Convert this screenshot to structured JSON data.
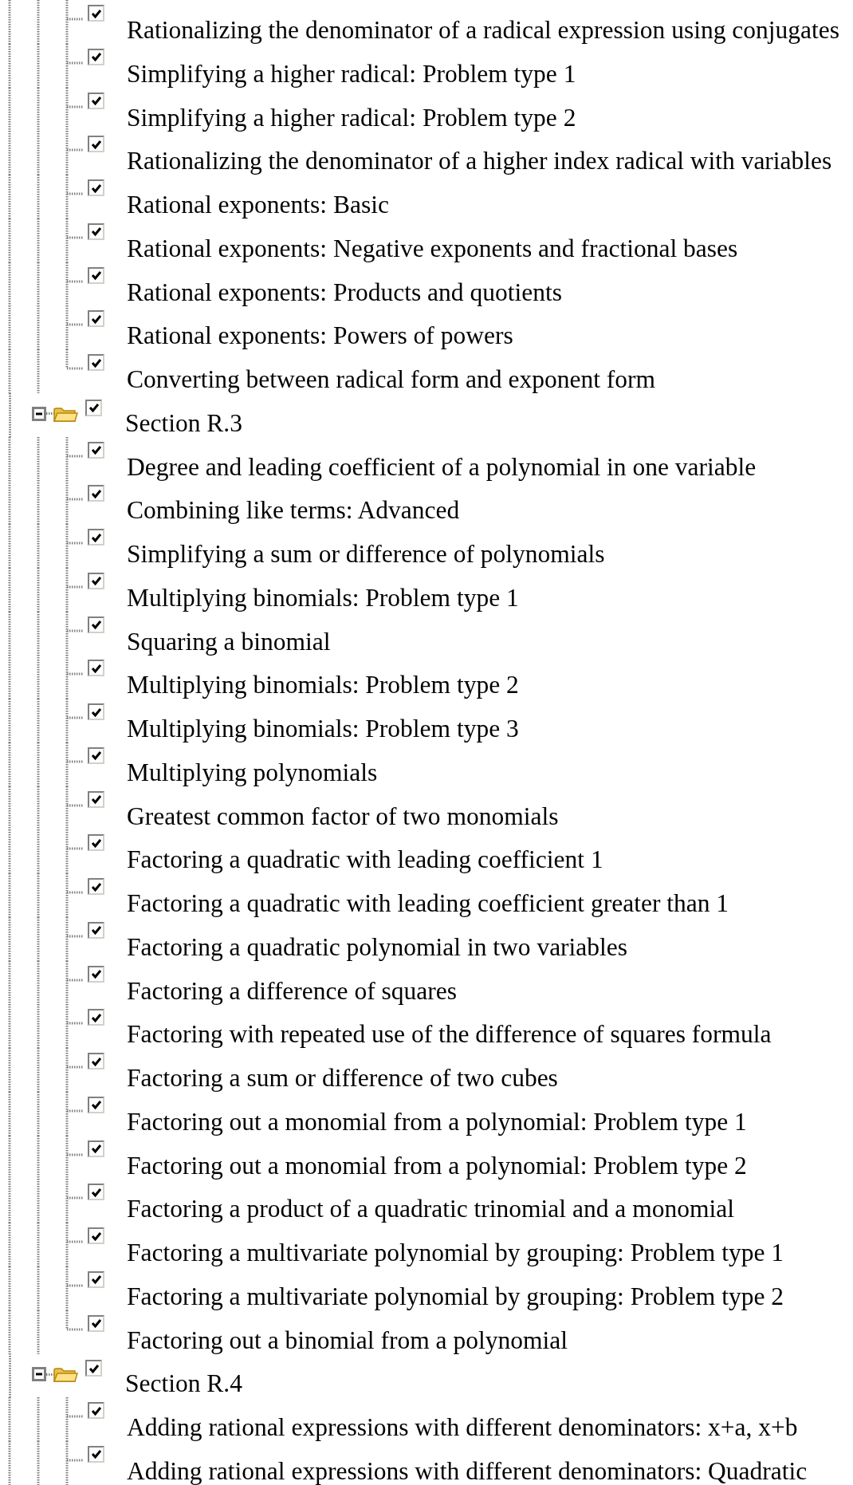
{
  "tree": [
    {
      "kind": "continued",
      "more_below": false,
      "children": [
        {
          "label": "Rationalizing the denominator of a radical expression using conjugates",
          "checked": true
        },
        {
          "label": "Simplifying a higher radical: Problem type 1",
          "checked": true
        },
        {
          "label": "Simplifying a higher radical: Problem type 2",
          "checked": true
        },
        {
          "label": "Rationalizing the denominator of a higher index radical with variables",
          "checked": true
        },
        {
          "label": "Rational exponents: Basic",
          "checked": true
        },
        {
          "label": "Rational exponents: Negative exponents and fractional bases",
          "checked": true
        },
        {
          "label": "Rational exponents: Products and quotients",
          "checked": true
        },
        {
          "label": "Rational exponents: Powers of powers",
          "checked": true
        },
        {
          "label": "Converting between radical form and exponent form",
          "checked": true
        }
      ]
    },
    {
      "kind": "section",
      "label": "Section R.3",
      "expanded": true,
      "checked": true,
      "more_below": false,
      "children": [
        {
          "label": "Degree and leading coefficient of a polynomial in one variable",
          "checked": true
        },
        {
          "label": "Combining like terms: Advanced",
          "checked": true
        },
        {
          "label": "Simplifying a sum or difference of polynomials",
          "checked": true
        },
        {
          "label": "Multiplying binomials: Problem type 1",
          "checked": true
        },
        {
          "label": "Squaring a binomial",
          "checked": true
        },
        {
          "label": "Multiplying binomials: Problem type 2",
          "checked": true
        },
        {
          "label": "Multiplying binomials: Problem type 3",
          "checked": true
        },
        {
          "label": "Multiplying polynomials",
          "checked": true
        },
        {
          "label": "Greatest common factor of two monomials",
          "checked": true
        },
        {
          "label": "Factoring a quadratic with leading coefficient 1",
          "checked": true
        },
        {
          "label": "Factoring a quadratic with leading coefficient greater than 1",
          "checked": true
        },
        {
          "label": "Factoring a quadratic polynomial in two variables",
          "checked": true
        },
        {
          "label": "Factoring a difference of squares",
          "checked": true
        },
        {
          "label": "Factoring with repeated use of the difference of squares formula",
          "checked": true
        },
        {
          "label": "Factoring a sum or difference of two cubes",
          "checked": true
        },
        {
          "label": "Factoring out a monomial from a polynomial: Problem type 1",
          "checked": true
        },
        {
          "label": "Factoring out a monomial from a polynomial: Problem type 2",
          "checked": true
        },
        {
          "label": "Factoring a product of a quadratic trinomial and a monomial",
          "checked": true
        },
        {
          "label": "Factoring a multivariate polynomial by grouping: Problem type 1",
          "checked": true
        },
        {
          "label": "Factoring a multivariate polynomial by grouping: Problem type 2",
          "checked": true
        },
        {
          "label": "Factoring out a binomial from a polynomial",
          "checked": true
        }
      ]
    },
    {
      "kind": "section",
      "label": "Section R.4",
      "expanded": true,
      "checked": true,
      "more_below": true,
      "children": [
        {
          "label": "Adding rational expressions with different denominators: x+a, x+b",
          "checked": true
        },
        {
          "label": "Adding rational expressions with different denominators: Quadratic",
          "checked": true
        }
      ]
    }
  ]
}
